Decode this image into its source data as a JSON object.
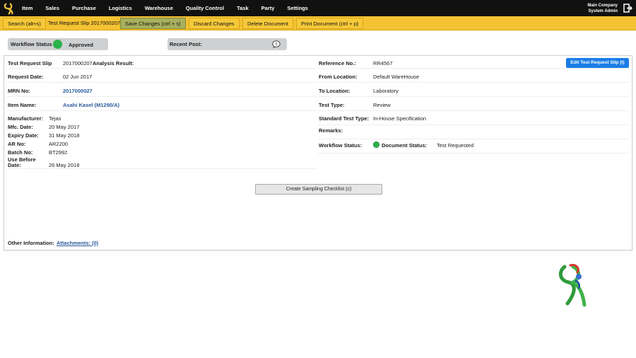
{
  "nav": {
    "items": [
      "Item",
      "Sales",
      "Purchase",
      "Logistics",
      "Warehouse",
      "Quality Control",
      "Task",
      "Party",
      "Settings"
    ],
    "company": "Main Company",
    "user": "System Admin"
  },
  "toolbar": {
    "search": "Search (alt+s)",
    "doc_title": "Test Request Slip 2017000207",
    "save": "Save Changes (ctrl + s)",
    "discard": "Discard Changes",
    "delete": "Delete Document",
    "print": "Print Document (ctrl + p)"
  },
  "status": {
    "workflow_label": "Workflow Status",
    "workflow_value": "Approved",
    "recent_post_label": "Recent Post:",
    "recent_post_count": "0"
  },
  "form": {
    "left": {
      "test_request_slip_label": "Test Request Slip",
      "test_request_slip_value": "2017000207",
      "analysis_result_label": "Analysis Result:",
      "request_date_label": "Request Date:",
      "request_date_value": "02 Jun 2017",
      "mrn_label": "MRN No:",
      "mrn_value": "2017000027",
      "item_name_label": "Item Name:",
      "item_name_value": "Asahi Kasel (M1290/A)",
      "manufacturer_label": "Manufacturer:",
      "manufacturer_value": "Tejas",
      "mfc_date_label": "Mfc. Date:",
      "mfc_date_value": "20 May 2017",
      "expiry_date_label": "Expiry Date:",
      "expiry_date_value": "31 May 2018",
      "ar_no_label": "AR No:",
      "ar_no_value": "AR2200",
      "batch_no_label": "Batch No:",
      "batch_no_value": "BT2992",
      "use_before_label_1": "Use Before",
      "use_before_label_2": "Date:",
      "use_before_value": "26 May 2018"
    },
    "right": {
      "reference_label": "Reference No.:",
      "reference_value": "RR4567",
      "edit_button": "Edit Test Request Slip (t)",
      "from_location_label": "From Location:",
      "from_location_value": "Default WareHouse",
      "to_location_label": "To Location:",
      "to_location_value": "Laboratory",
      "test_type_label": "Test Type:",
      "test_type_value": "Review",
      "standard_test_type_label": "Standard Test Type:",
      "standard_test_type_value": "In-House Specification",
      "remarks_label": "Remarks:",
      "workflow_status_label": "Workflow Status:",
      "document_status_label": "Document Status:",
      "document_status_value": "Test Requested"
    },
    "create_checklist_button": "Create Sampling Checklist (c)",
    "other_info_label": "Other Information:",
    "attachments_link": "Attachments: (0)"
  },
  "colors": {
    "toolbar_bg": "#f4c232",
    "save_button": "#a8b05e",
    "edit_button": "#1a7de8",
    "status_green": "#2bb24c",
    "link": "#2a5a9c"
  }
}
